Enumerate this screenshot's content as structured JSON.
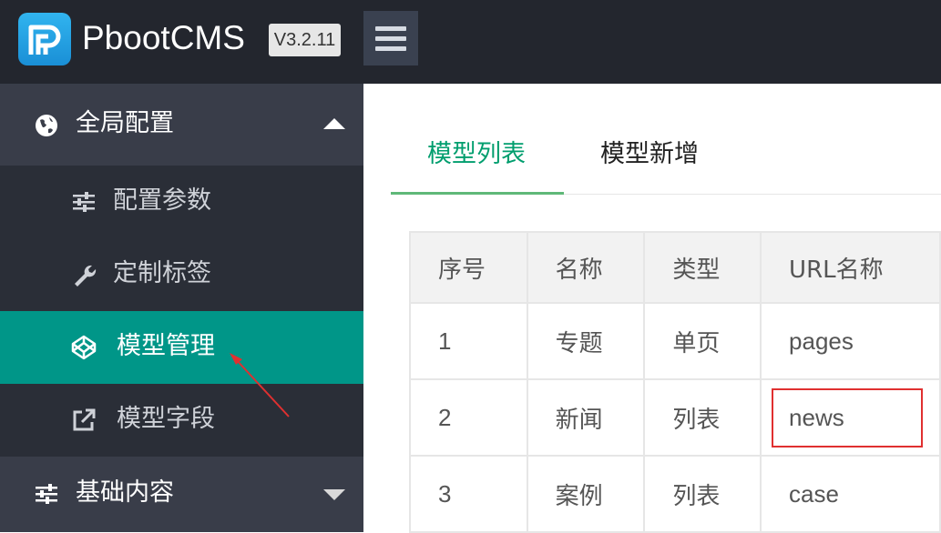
{
  "header": {
    "brand": "PbootCMS",
    "version": "V3.2.11",
    "logo_icon": "pboot-logo-icon",
    "menu_icon": "hamburger-icon"
  },
  "sidebar": {
    "groups": [
      {
        "label": "全局配置",
        "icon": "globe-icon",
        "expanded": true
      },
      {
        "label": "基础内容",
        "icon": "sliders-icon",
        "expanded": false
      }
    ],
    "items": [
      {
        "label": "配置参数",
        "icon": "sliders-icon",
        "active": false
      },
      {
        "label": "定制标签",
        "icon": "wrench-icon",
        "active": false
      },
      {
        "label": "模型管理",
        "icon": "codepen-icon",
        "active": true
      },
      {
        "label": "模型字段",
        "icon": "external-link-icon",
        "active": false
      }
    ]
  },
  "main": {
    "tabs": [
      {
        "label": "模型列表",
        "active": true
      },
      {
        "label": "模型新增",
        "active": false
      }
    ],
    "table": {
      "headers": [
        "序号",
        "名称",
        "类型",
        "URL名称"
      ],
      "rows": [
        [
          "1",
          "专题",
          "单页",
          "pages"
        ],
        [
          "2",
          "新闻",
          "列表",
          "news"
        ],
        [
          "3",
          "案例",
          "列表",
          "case"
        ]
      ]
    }
  },
  "colors": {
    "header_bg": "#23262e",
    "sidebar_bg": "#2a2e37",
    "active_item": "#009688",
    "tab_active": "#009e6e",
    "annotation": "#e03030"
  }
}
